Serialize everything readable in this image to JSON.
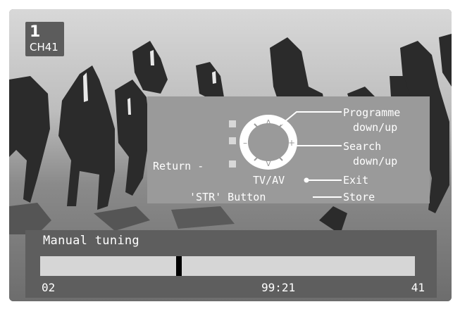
{
  "channel": {
    "number": "1",
    "name": "CH41"
  },
  "keys": {
    "programme": [
      "Programme",
      "down/up"
    ],
    "search": [
      "Search",
      "down/up"
    ],
    "return": "Return -",
    "tvav": "TV/AV",
    "exit": "Exit",
    "str_button": "'STR' Button",
    "store": "Store",
    "symbols": {
      "up": "Λ",
      "down": "V",
      "minus": "–",
      "plus": "+"
    }
  },
  "tuning": {
    "title": "Manual tuning",
    "left_value": "02",
    "center_value": "99:21",
    "right_value": "41",
    "progress": 0.37
  }
}
